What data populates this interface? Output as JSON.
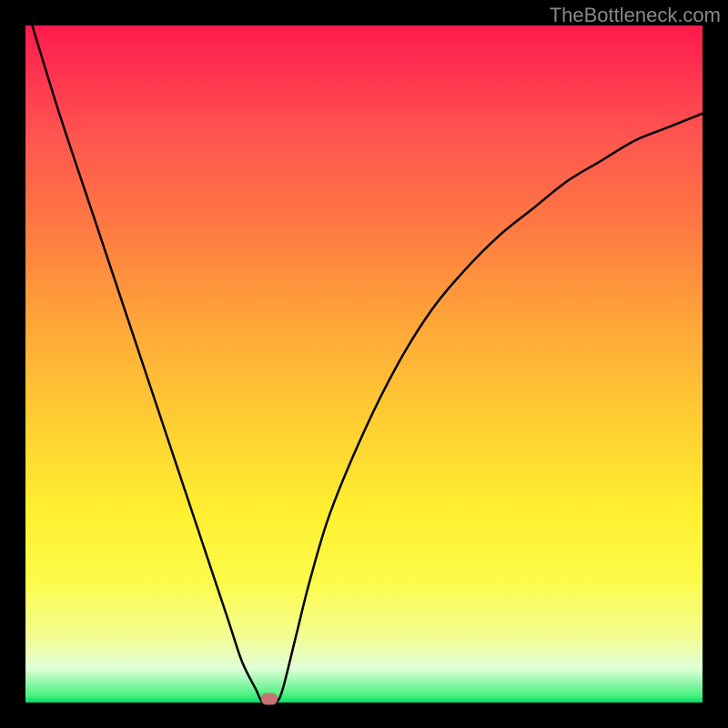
{
  "watermark": "TheBottleneck.com",
  "chart_data": {
    "type": "line",
    "title": "",
    "xlabel": "",
    "ylabel": "",
    "xlim": [
      0,
      100
    ],
    "ylim": [
      0,
      100
    ],
    "x": [
      1,
      5,
      10,
      15,
      20,
      25,
      28,
      30,
      32,
      34,
      35,
      36,
      37,
      38,
      40,
      42,
      45,
      50,
      55,
      60,
      65,
      70,
      75,
      80,
      85,
      90,
      95,
      100
    ],
    "values": [
      100,
      87,
      72,
      57,
      42,
      27,
      18,
      12,
      6,
      2,
      0,
      0,
      0,
      2,
      10,
      18,
      28,
      40,
      50,
      58,
      64,
      69,
      73,
      77,
      80,
      83,
      85,
      87
    ],
    "minimum_x": 35,
    "minimum_y": 0,
    "marker": {
      "x": 36,
      "y": 0
    }
  }
}
